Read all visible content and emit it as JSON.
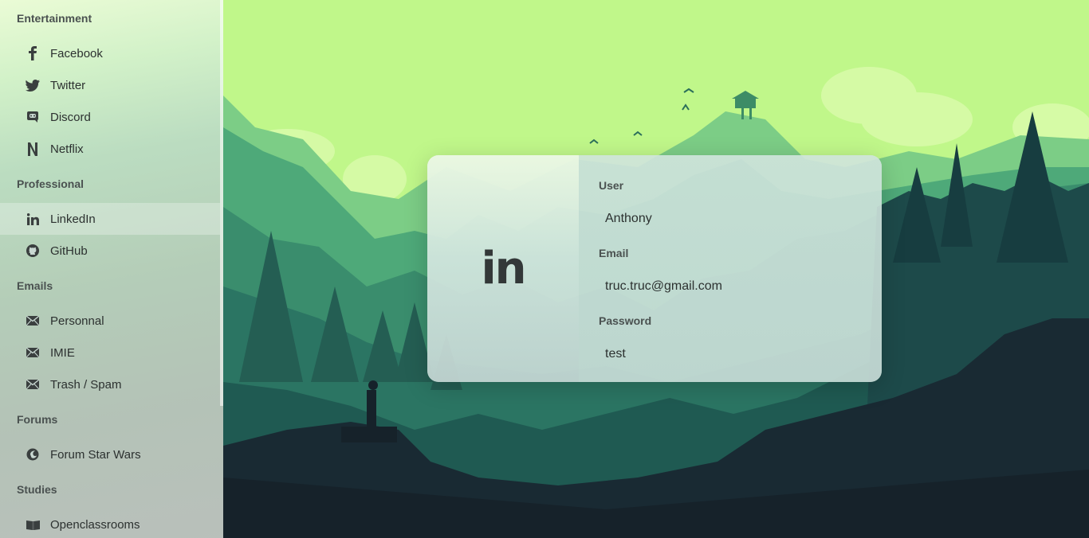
{
  "sidebar": {
    "sections": [
      {
        "title": "Entertainment"
      },
      {
        "title": "Professional"
      },
      {
        "title": "Emails"
      },
      {
        "title": "Forums"
      },
      {
        "title": "Studies"
      }
    ],
    "items": [
      {
        "label": "Facebook",
        "icon": "facebook-icon"
      },
      {
        "label": "Twitter",
        "icon": "twitter-icon"
      },
      {
        "label": "Discord",
        "icon": "discord-icon"
      },
      {
        "label": "Netflix",
        "icon": "netflix-icon"
      },
      {
        "label": "LinkedIn",
        "icon": "linkedin-icon",
        "active": true
      },
      {
        "label": "GitHub",
        "icon": "github-icon"
      },
      {
        "label": "Personnal",
        "icon": "envelope-icon"
      },
      {
        "label": "IMIE",
        "icon": "envelope-icon"
      },
      {
        "label": "Trash / Spam",
        "icon": "envelope-icon"
      },
      {
        "label": "Forum Star Wars",
        "icon": "rebel-icon"
      },
      {
        "label": "Openclassrooms",
        "icon": "book-icon"
      }
    ]
  },
  "card": {
    "logo": "in",
    "user_label": "User",
    "user_value": "Anthony",
    "email_label": "Email",
    "email_value": "truc.truc@gmail.com",
    "password_label": "Password",
    "password_value": "test"
  },
  "colors": {
    "sky": "#c0f78a",
    "text_dark": "#2c3130",
    "section_title": "#4a5150"
  }
}
